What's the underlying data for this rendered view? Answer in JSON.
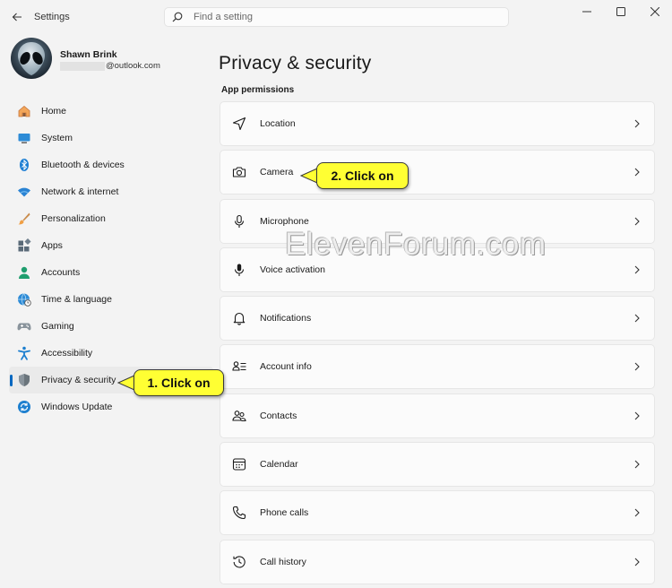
{
  "window": {
    "app_title": "Settings",
    "search_placeholder": "Find a setting",
    "controls": [
      "minimize-icon",
      "maximize-icon",
      "close-icon"
    ]
  },
  "profile": {
    "name": "Shawn Brink",
    "email_suffix": "@outlook.com"
  },
  "sidebar": {
    "items": [
      {
        "label": "Home",
        "icon": "home-icon"
      },
      {
        "label": "System",
        "icon": "system-icon"
      },
      {
        "label": "Bluetooth & devices",
        "icon": "bluetooth-icon"
      },
      {
        "label": "Network & internet",
        "icon": "wifi-icon"
      },
      {
        "label": "Personalization",
        "icon": "brush-icon"
      },
      {
        "label": "Apps",
        "icon": "apps-icon"
      },
      {
        "label": "Accounts",
        "icon": "accounts-icon"
      },
      {
        "label": "Time & language",
        "icon": "globe-clock-icon"
      },
      {
        "label": "Gaming",
        "icon": "gamepad-icon"
      },
      {
        "label": "Accessibility",
        "icon": "accessibility-icon"
      },
      {
        "label": "Privacy & security",
        "icon": "shield-icon",
        "selected": true
      },
      {
        "label": "Windows Update",
        "icon": "update-icon"
      }
    ],
    "accent_color": "#0067c0"
  },
  "main": {
    "title": "Privacy & security",
    "section_title": "App permissions",
    "rows": [
      {
        "label": "Location",
        "icon": "location-icon"
      },
      {
        "label": "Camera",
        "icon": "camera-icon"
      },
      {
        "label": "Microphone",
        "icon": "microphone-icon"
      },
      {
        "label": "Voice activation",
        "icon": "voice-activation-icon"
      },
      {
        "label": "Notifications",
        "icon": "bell-icon"
      },
      {
        "label": "Account info",
        "icon": "account-info-icon"
      },
      {
        "label": "Contacts",
        "icon": "contacts-icon"
      },
      {
        "label": "Calendar",
        "icon": "calendar-icon"
      },
      {
        "label": "Phone calls",
        "icon": "phone-icon"
      },
      {
        "label": "Call history",
        "icon": "history-icon"
      }
    ]
  },
  "annotations": {
    "callout_1": "1. Click on",
    "callout_2": "2. Click on",
    "callout_color": "#ffff33",
    "watermark": "ElevenForum.com"
  }
}
